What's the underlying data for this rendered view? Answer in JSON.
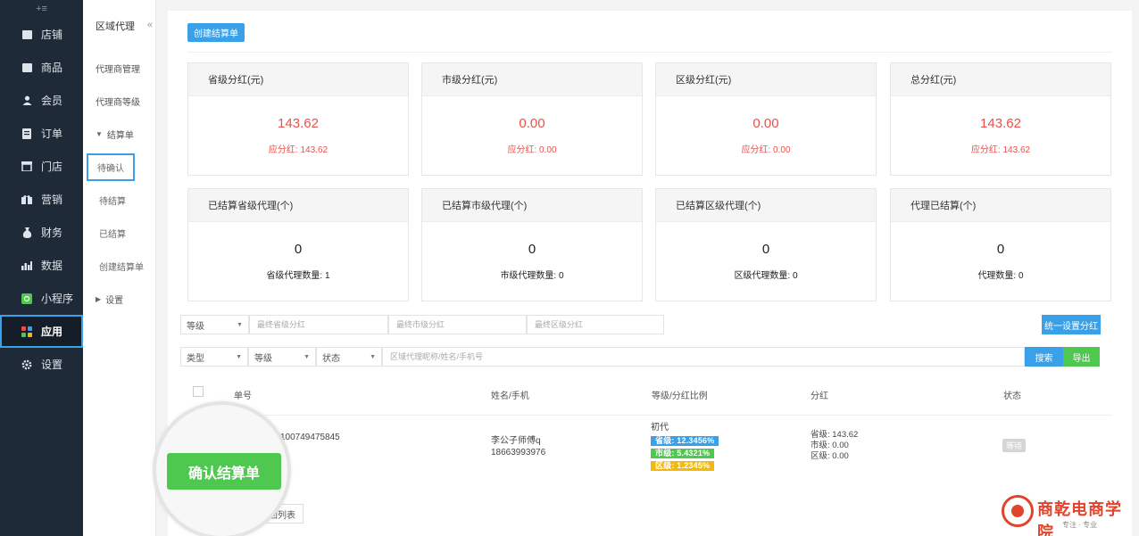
{
  "sidebar": {
    "collapse_icon": "+≡",
    "items": [
      {
        "label": "店铺",
        "icon": "store-icon"
      },
      {
        "label": "商品",
        "icon": "goods-icon"
      },
      {
        "label": "会员",
        "icon": "member-icon"
      },
      {
        "label": "订单",
        "icon": "order-icon"
      },
      {
        "label": "门店",
        "icon": "shop-icon"
      },
      {
        "label": "营销",
        "icon": "marketing-icon"
      },
      {
        "label": "财务",
        "icon": "finance-icon"
      },
      {
        "label": "数据",
        "icon": "data-icon"
      },
      {
        "label": "小程序",
        "icon": "miniprogram-icon"
      },
      {
        "label": "应用",
        "icon": "apps-icon",
        "active": true
      },
      {
        "label": "设置",
        "icon": "gear-icon"
      }
    ]
  },
  "subnav": {
    "title": "区域代理",
    "fold_icon": "«",
    "items": [
      {
        "label": "代理商管理"
      },
      {
        "label": "代理商等级"
      },
      {
        "label": "结算单"
      },
      {
        "label": "待确认"
      },
      {
        "label": "待结算"
      },
      {
        "label": "已结算"
      },
      {
        "label": "创建结算单"
      },
      {
        "label": "设置"
      }
    ]
  },
  "toolbar": {
    "create_label": "创建结算单"
  },
  "cards": [
    {
      "title": "省级分红(元)",
      "value": "143.62",
      "sub": "应分红: 143.62"
    },
    {
      "title": "市级分红(元)",
      "value": "0.00",
      "sub": "应分红: 0.00"
    },
    {
      "title": "区级分红(元)",
      "value": "0.00",
      "sub": "应分红: 0.00"
    },
    {
      "title": "总分红(元)",
      "value": "143.62",
      "sub": "应分红: 143.62"
    },
    {
      "title": "已结算省级代理(个)",
      "value": "0",
      "sub": "省级代理数量: 1"
    },
    {
      "title": "已结算市级代理(个)",
      "value": "0",
      "sub": "市级代理数量: 0"
    },
    {
      "title": "已结算区级代理(个)",
      "value": "0",
      "sub": "区级代理数量: 0"
    },
    {
      "title": "代理已结算(个)",
      "value": "0",
      "sub": "代理数量: 0"
    }
  ],
  "filters": {
    "level_select": "等级",
    "province_placeholder": "最终省级分红",
    "city_placeholder": "最终市级分红",
    "district_placeholder": "最终区级分红",
    "set_button": "统一设置分红",
    "type_select": "类型",
    "level_select_2": "等级",
    "status_select": "状态",
    "search_placeholder": "区域代理昵称/姓名/手机号",
    "search_button": "搜索",
    "export_button": "导出"
  },
  "table": {
    "headers": [
      "单号",
      "姓名/手机",
      "等级/分红比例",
      "分红",
      "状态"
    ],
    "row": {
      "order_no": "100749475845",
      "name": "李公子师傅q",
      "phone": "18663993976",
      "level": "初代",
      "ratio_province": "省级: 12.3456%",
      "ratio_city": "市级: 5.4321%",
      "ratio_district": "区级: 1.2345%",
      "bonus_province": "省级: 143.62",
      "bonus_city": "市级: 0.00",
      "bonus_district": "区级: 0.00",
      "status": "等待"
    }
  },
  "actions": {
    "confirm_label": "确认结算单",
    "back_label": "回列表"
  },
  "logo": {
    "brand": "商乾电商学院",
    "slogan": "专注 · 专业"
  },
  "colors": {
    "accent": "#3aa0e8",
    "success": "#4fc84f",
    "danger": "#e9504a",
    "warning": "#f5b90c",
    "sidebar_bg": "#1f2a38"
  }
}
